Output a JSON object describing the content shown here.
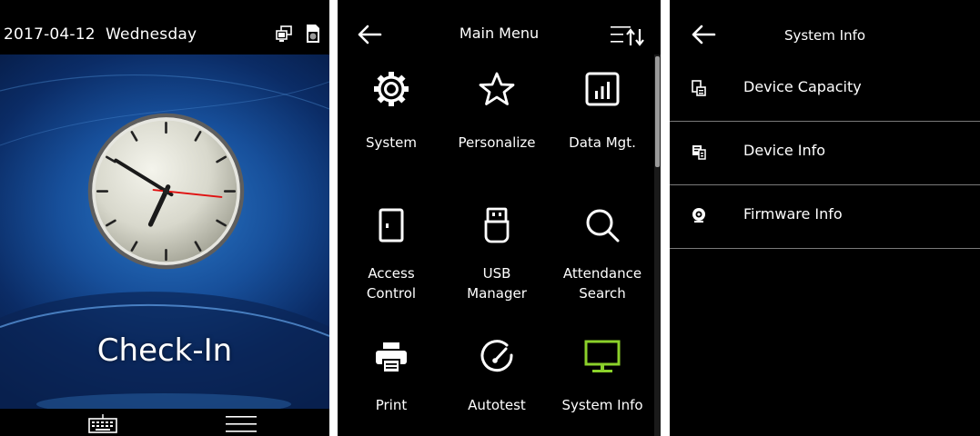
{
  "screen1": {
    "date": "2017-04-12",
    "weekday": "Wednesday",
    "status_icons": [
      "network-icon",
      "sd-card-icon"
    ],
    "clock": {
      "hour": 6,
      "minute": 50,
      "second": 16
    },
    "state_label": "Check-In",
    "bottom_icons": [
      "keyboard-icon",
      "menu-icon"
    ]
  },
  "screen2": {
    "title": "Main Menu",
    "items": [
      {
        "label": "System",
        "icon": "gear-icon"
      },
      {
        "label": "Personalize",
        "icon": "star-icon"
      },
      {
        "label": "Data Mgt.",
        "icon": "bar-chart-icon"
      },
      {
        "label_lines": [
          "Access",
          "Control"
        ],
        "icon": "door-icon"
      },
      {
        "label_lines": [
          "USB",
          "Manager"
        ],
        "icon": "usb-drive-icon"
      },
      {
        "label_lines": [
          "Attendance",
          "Search"
        ],
        "icon": "magnifier-icon"
      },
      {
        "label": "Print",
        "icon": "printer-icon"
      },
      {
        "label": "Autotest",
        "icon": "gauge-icon"
      },
      {
        "label": "System Info",
        "icon": "monitor-icon",
        "accent": "#8bd12a"
      }
    ]
  },
  "screen3": {
    "title": "System Info",
    "items": [
      {
        "label": "Device Capacity",
        "icon": "capacity-icon"
      },
      {
        "label": "Device Info",
        "icon": "device-info-icon"
      },
      {
        "label": "Firmware Info",
        "icon": "firmware-icon"
      }
    ]
  }
}
